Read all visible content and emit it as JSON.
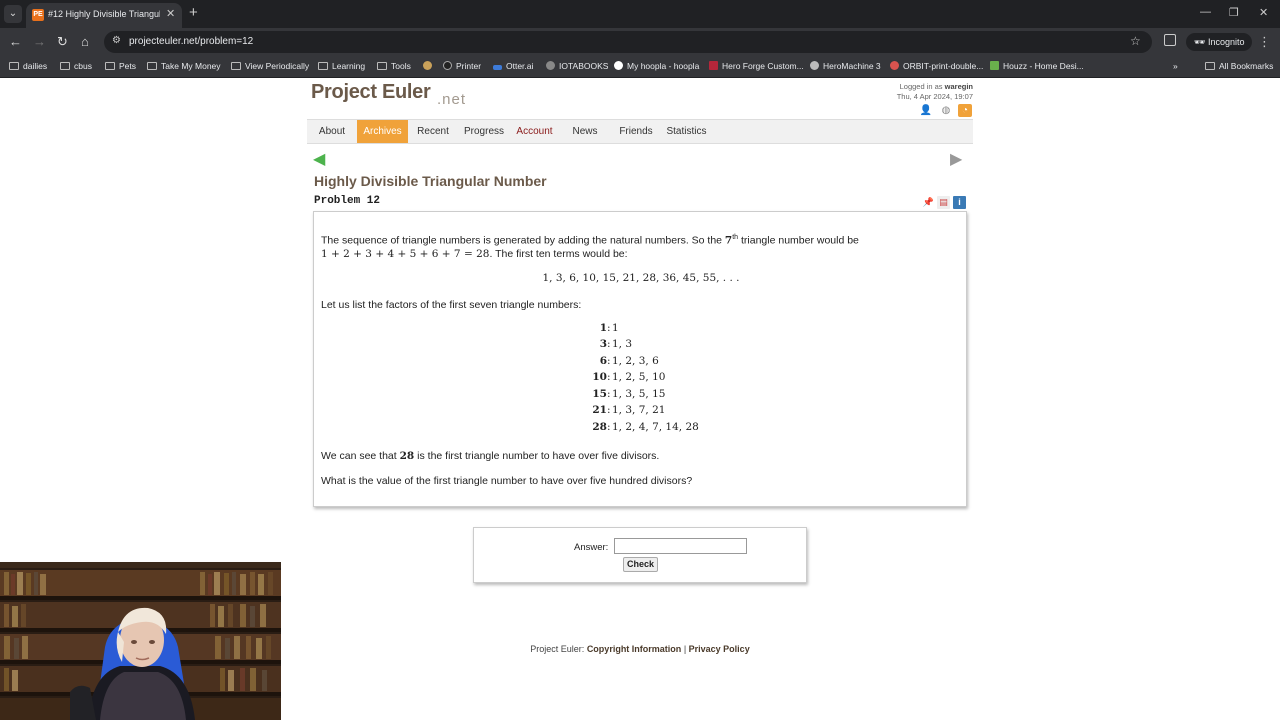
{
  "browser": {
    "tab_title": "#12 Highly Divisible Triangular",
    "tab_favicon": "PE",
    "url": "projecteuler.net/problem=12",
    "incognito_label": "Incognito",
    "bookmarks": [
      {
        "label": "dailies",
        "icon": "folder-icon"
      },
      {
        "label": "cbus",
        "icon": "folder-icon"
      },
      {
        "label": "Pets",
        "icon": "folder-icon"
      },
      {
        "label": "Take My Money",
        "icon": "folder-icon"
      },
      {
        "label": "View Periodically",
        "icon": "folder-icon"
      },
      {
        "label": "Learning",
        "icon": "folder-icon"
      },
      {
        "label": "Tools",
        "icon": "folder-icon"
      },
      {
        "label": "Printer",
        "icon": "site-icon"
      },
      {
        "label": "Otter.ai",
        "icon": "site-icon"
      },
      {
        "label": "IOTABOOKS",
        "icon": "site-icon"
      },
      {
        "label": "My hoopla - hoopla",
        "icon": "site-icon"
      },
      {
        "label": "Hero Forge Custom...",
        "icon": "site-icon"
      },
      {
        "label": "HeroMachine 3",
        "icon": "site-icon"
      },
      {
        "label": "ORBIT-print-double...",
        "icon": "site-icon"
      },
      {
        "label": "Houzz - Home Desi...",
        "icon": "site-icon"
      }
    ],
    "all_bookmarks_label": "All Bookmarks"
  },
  "site": {
    "logo": "Project Euler",
    "logo_suffix": ".net",
    "login_prefix": "Logged in as",
    "username": "waregin",
    "datetime": "Thu, 4 Apr 2024, 19:07",
    "nav": [
      "About",
      "Archives",
      "Recent",
      "Progress",
      "Account",
      "News",
      "Friends",
      "Statistics"
    ]
  },
  "problem": {
    "title": "Highly Divisible Triangular Number",
    "number": "Problem 12",
    "intro_1a": "The sequence of triangle numbers is generated by adding the natural numbers. So the ",
    "intro_1_ord": "7",
    "intro_1_sup": "th",
    "intro_1b": " triangle number would be",
    "intro_2_math": "1 + 2 + 3 + 4 + 5 + 6 + 7 = 28",
    "intro_2b": ". The first ten terms would be:",
    "sequence": "1, 3, 6, 10, 15, 21, 28, 36, 45, 55, . . .",
    "list_intro": "Let us list the factors of the first seven triangle numbers:",
    "factors": [
      {
        "n": "1",
        "f": "1"
      },
      {
        "n": "3",
        "f": "1, 3"
      },
      {
        "n": "6",
        "f": "1, 2, 3, 6"
      },
      {
        "n": "10",
        "f": "1, 2, 5, 10"
      },
      {
        "n": "15",
        "f": "1, 3, 5, 15"
      },
      {
        "n": "21",
        "f": "1, 3, 7, 21"
      },
      {
        "n": "28",
        "f": "1, 2, 4, 7, 14, 28"
      }
    ],
    "observation_a": "We can see that ",
    "observation_num": "28",
    "observation_b": " is the first triangle number to have over five divisors.",
    "question": "What is the value of the first triangle number to have over five hundred divisors?"
  },
  "answer": {
    "label": "Answer:",
    "value": "",
    "check_label": "Check"
  },
  "footer": {
    "prefix": "Project Euler: ",
    "copyright": "Copyright Information",
    "sep": " | ",
    "privacy": "Privacy Policy"
  }
}
